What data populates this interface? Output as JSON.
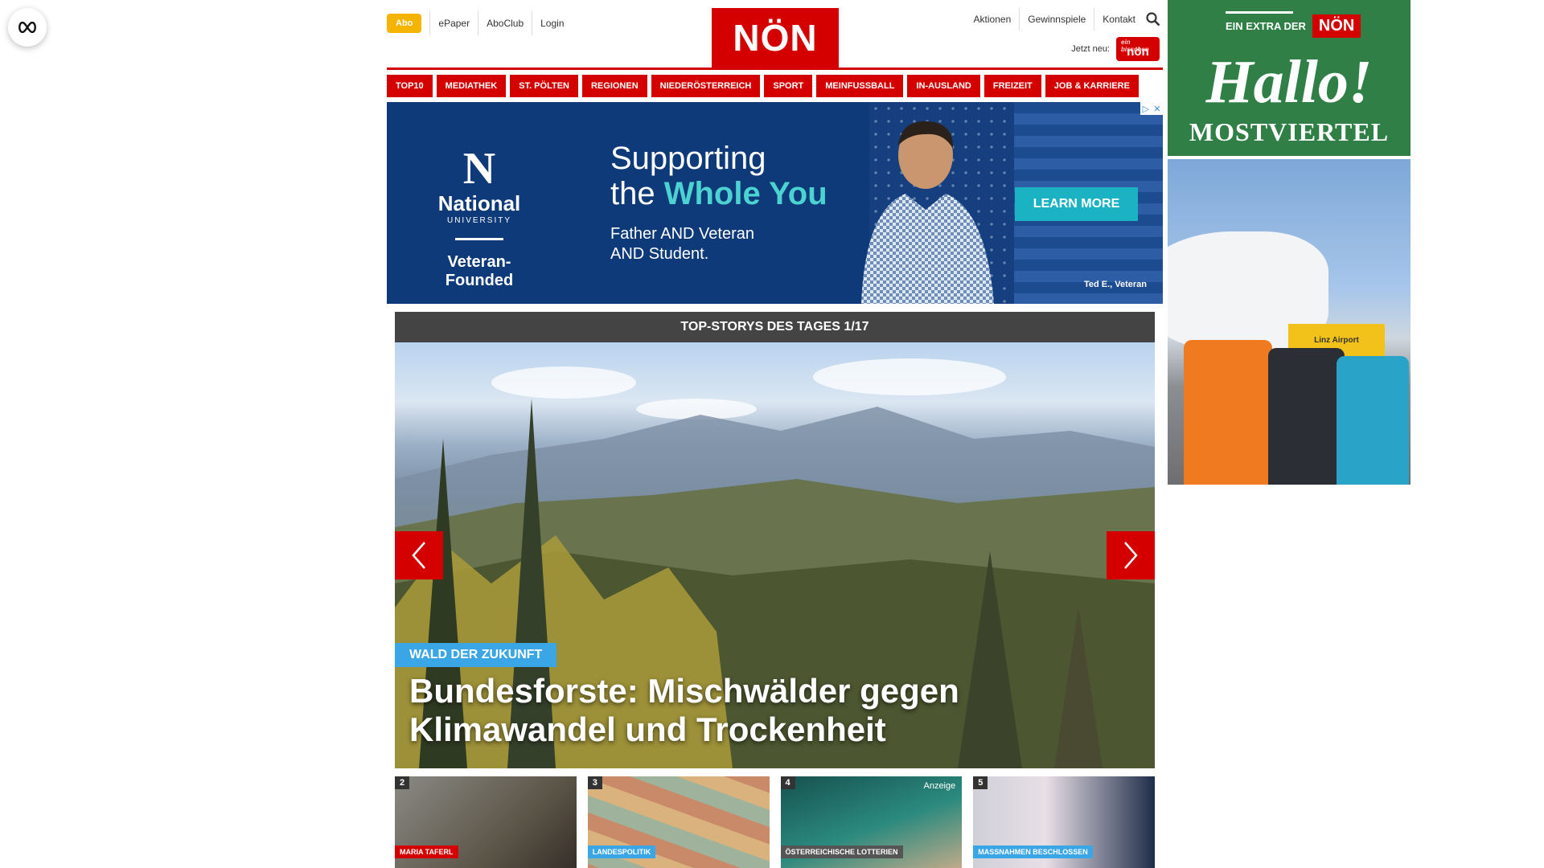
{
  "header": {
    "abo": "Abo",
    "links_left": [
      "ePaper",
      "AboClub",
      "Login"
    ],
    "logo": "NÖN",
    "links_right": [
      "Aktionen",
      "Gewinnspiele",
      "Kontakt"
    ],
    "jetzt_neu": "Jetzt neu:",
    "mini_logo_tag": "ein bisschen",
    "mini_logo_text": "nön"
  },
  "nav": [
    "TOP10",
    "MEDIATHEK",
    "ST. PÖLTEN",
    "REGIONEN",
    "NIEDERÖSTERREICH",
    "SPORT",
    "MEINFUSSBALL",
    "IN-AUSLAND",
    "FREIZEIT",
    "JOB & KARRIERE"
  ],
  "ad": {
    "brand_letter": "N",
    "brand_name": "National",
    "brand_sub": "UNIVERSITY",
    "brand_tagline": "Veteran-Founded",
    "headline_1": "Supporting",
    "headline_2a": "the ",
    "headline_2b": "Whole You",
    "sub_1": "Father AND Veteran",
    "sub_2": "AND Student.",
    "cta": "LEARN MORE",
    "caption": "Ted E., Veteran",
    "accent_color": "#1bb3c4"
  },
  "stories": {
    "heading": "TOP-STORYS DES TAGES 1/17",
    "kicker": "WALD DER ZUKUNFT",
    "headline": "Bundesforste: Mischwälder gegen Klimawandel und Trockenheit",
    "thumbs": [
      {
        "num": "2",
        "label": "MARIA TAFERL"
      },
      {
        "num": "3",
        "label": "LANDESPOLITIK"
      },
      {
        "num": "4",
        "label": "ÖSTERREICHISCHE LOTTERIEN",
        "badge": "Anzeige"
      },
      {
        "num": "5",
        "label": "MASSNAHMEN BESCHLOSSEN"
      }
    ]
  },
  "side_ad": {
    "extra": "EIN EXTRA DER",
    "nonbox": "NÖN",
    "hallo": "Hallo!",
    "region": "MOSTVIERTEL",
    "airport_sign": "Linz Airport"
  },
  "colors": {
    "brand": "#d40000",
    "abo": "#f5b400",
    "kicker": "#3aa6e6"
  }
}
